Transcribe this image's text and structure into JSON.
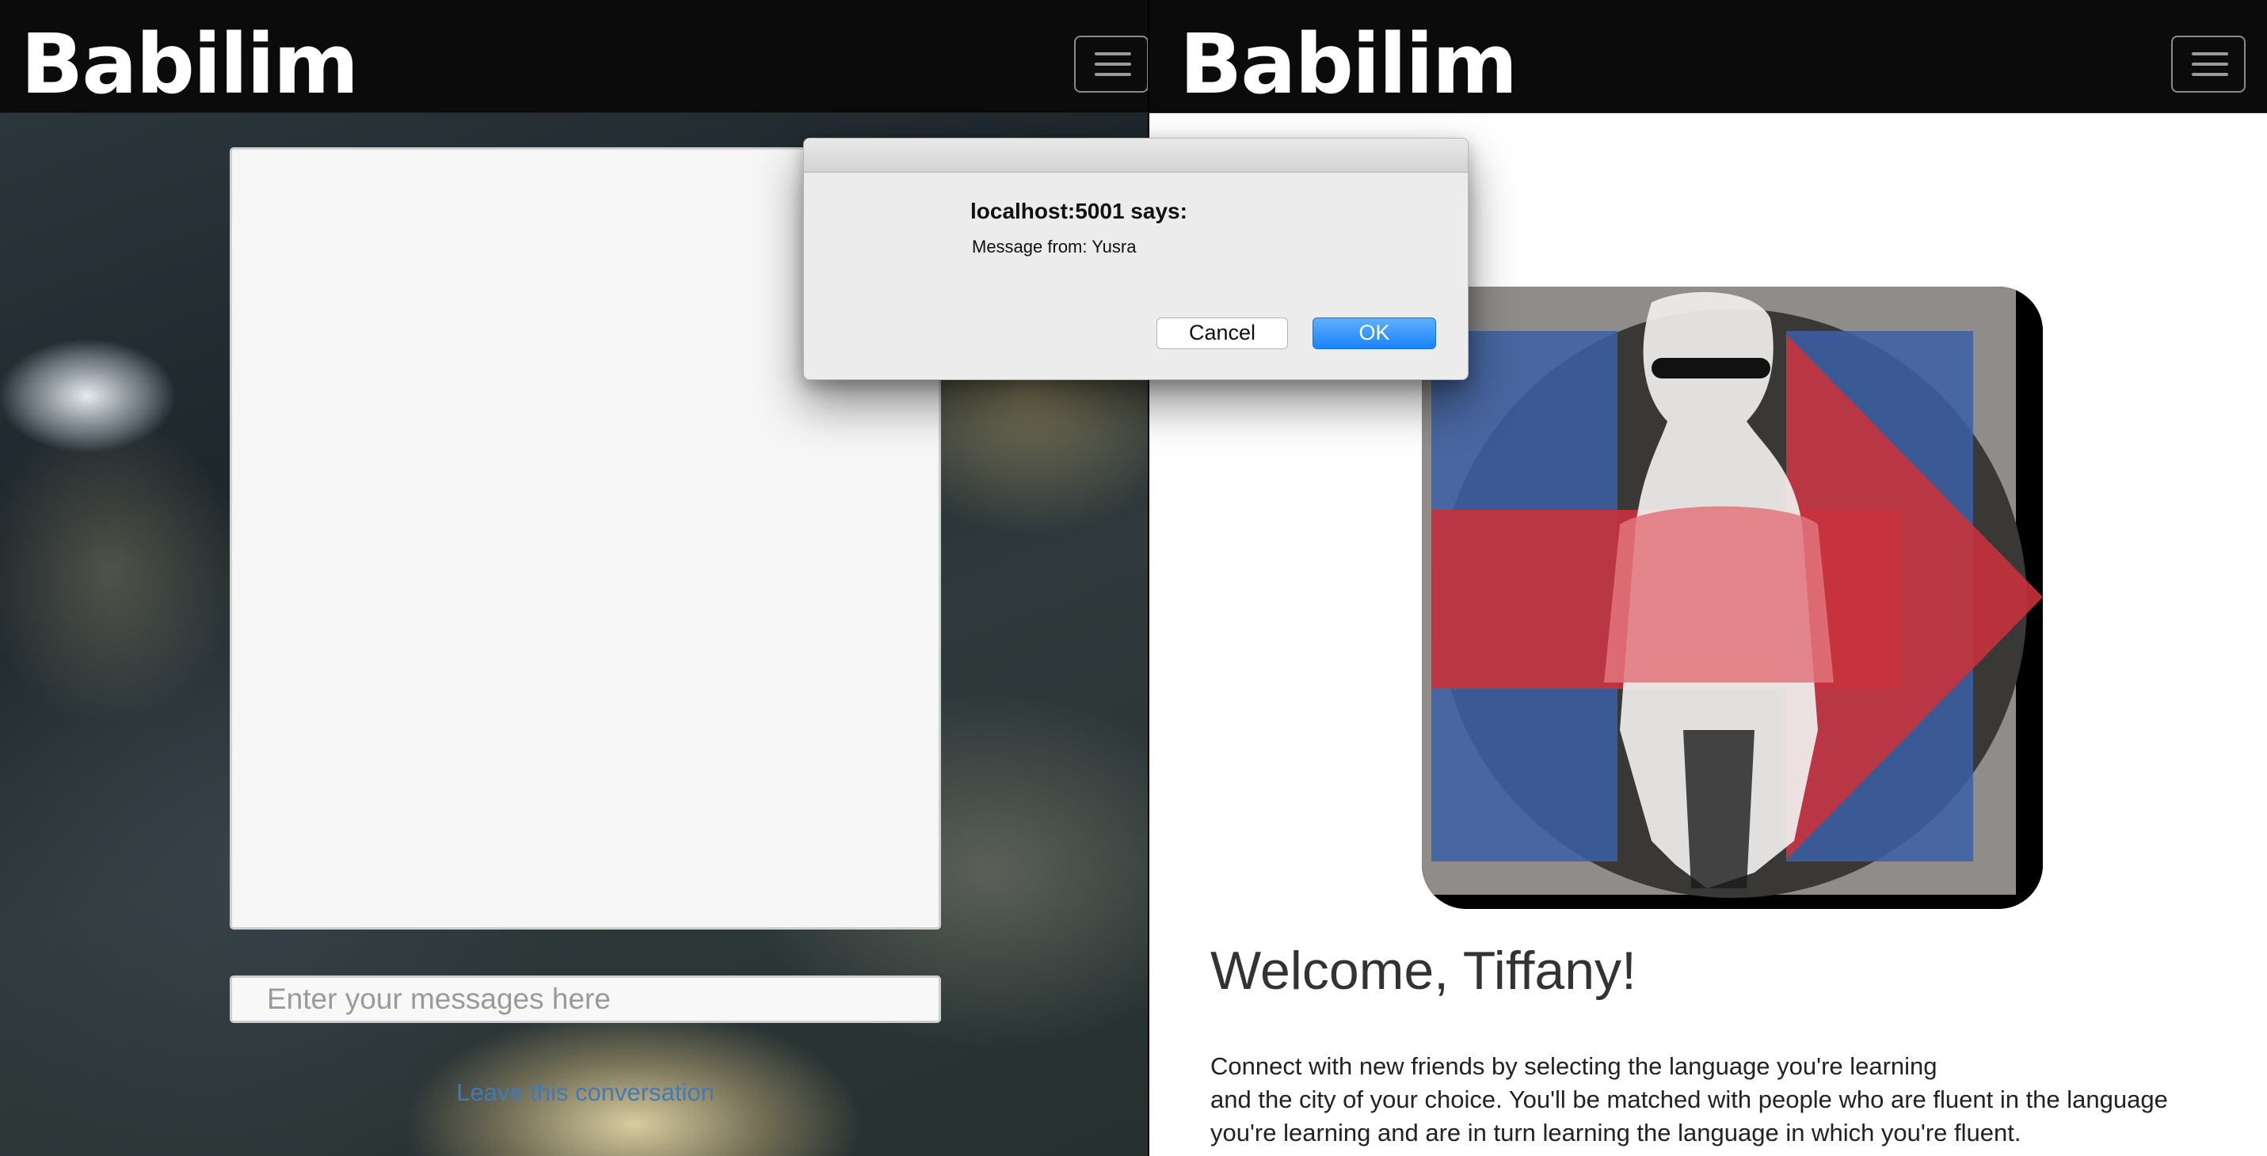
{
  "left_window": {
    "brand": "Babilim",
    "message_input": {
      "placeholder": "Enter your messages here",
      "value": ""
    },
    "leave_link": "Leave this conversation"
  },
  "right_window": {
    "brand": "Babilim",
    "welcome_heading": "Welcome, Tiffany!",
    "intro_lines": [
      "Connect with new friends by selecting the language you're learning",
      "and the city of your choice. You'll be matched with people who are fluent in the language",
      "you're learning and are in turn learning the language in which you're fluent."
    ]
  },
  "alert_dialog": {
    "title": "localhost:5001 says:",
    "message": "Message from: Yusra",
    "cancel_label": "Cancel",
    "ok_label": "OK"
  },
  "icons": {
    "menu_toggle": "hamburger-menu-icon"
  },
  "colors": {
    "navbar": "#0b0b0b",
    "link": "#3f7bb8",
    "ok_button": "#1a82fb",
    "photo_red": "#c8323c",
    "photo_blue": "#3c5fa5"
  }
}
